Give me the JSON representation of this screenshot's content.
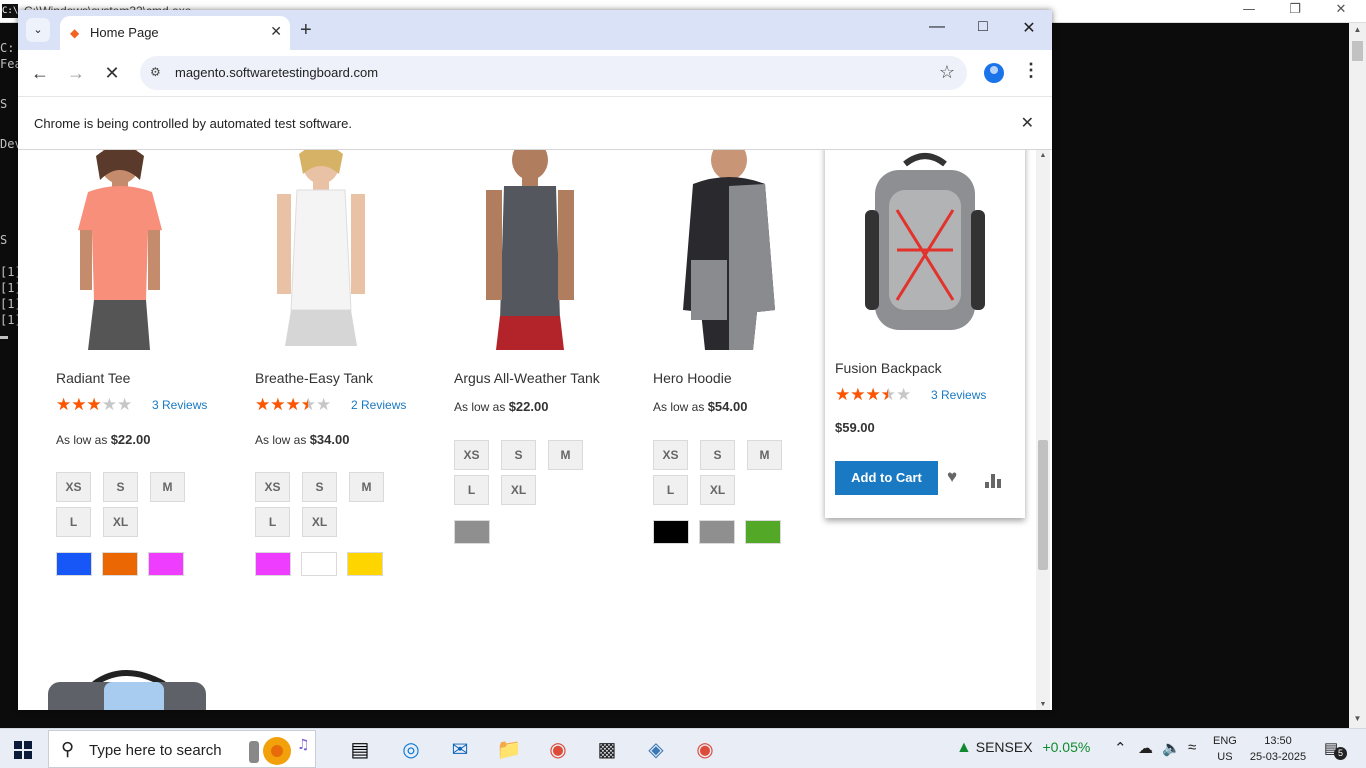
{
  "console": {
    "title": "C:\\Windows\\system32\\cmd.exe",
    "lines": [
      "C:",
      "Fea",
      "",
      "S",
      "",
      "",
      "Dev",
      "",
      "",
      "",
      "S",
      "",
      "[1]",
      "[1]",
      "[1]",
      "[1]"
    ]
  },
  "browser": {
    "tab_title": "Home Page",
    "url": "magento.softwaretestingboard.com",
    "infobar_message": "Chrome is being controlled by automated test software."
  },
  "products": [
    {
      "name": "Radiant Tee",
      "rating_fraction": 0.6,
      "reviews": "3 Reviews",
      "price_prefix": "As low as",
      "price": "$22.00",
      "sizes": [
        "XS",
        "S",
        "M",
        "L",
        "XL"
      ],
      "colors": [
        "#1857f7",
        "#eb6703",
        "#ef3dff"
      ]
    },
    {
      "name": "Breathe-Easy Tank",
      "rating_fraction": 0.7,
      "reviews": "2 Reviews",
      "price_prefix": "As low as",
      "price": "$34.00",
      "sizes": [
        "XS",
        "S",
        "M",
        "L",
        "XL"
      ],
      "colors": [
        "#ef3dff",
        "#ffffff",
        "#ffd500"
      ]
    },
    {
      "name": "Argus All-Weather Tank",
      "price_prefix": "As low as",
      "price": "$22.00",
      "sizes": [
        "XS",
        "S",
        "M",
        "L",
        "XL"
      ],
      "colors": [
        "#8f8f8f"
      ]
    },
    {
      "name": "Hero Hoodie",
      "price_prefix": "As low as",
      "price": "$54.00",
      "sizes": [
        "XS",
        "S",
        "M",
        "L",
        "XL"
      ],
      "colors": [
        "#000000",
        "#8f8f8f",
        "#53a828"
      ]
    },
    {
      "name": "Fusion Backpack",
      "rating_fraction": 0.7,
      "reviews": "3 Reviews",
      "price": "$59.00",
      "add_to_cart": "Add to Cart"
    }
  ],
  "taskbar": {
    "search_placeholder": "Type here to search",
    "sensex_label": "SENSEX",
    "sensex_change": "+0.05%",
    "lang_top": "ENG",
    "lang_bottom": "US",
    "time": "13:50",
    "date": "25-03-2025",
    "notification_count": "5"
  },
  "colors": {
    "accent": "#1979c3",
    "star_fill": "#ff5501",
    "magento_orange": "#f26322"
  }
}
